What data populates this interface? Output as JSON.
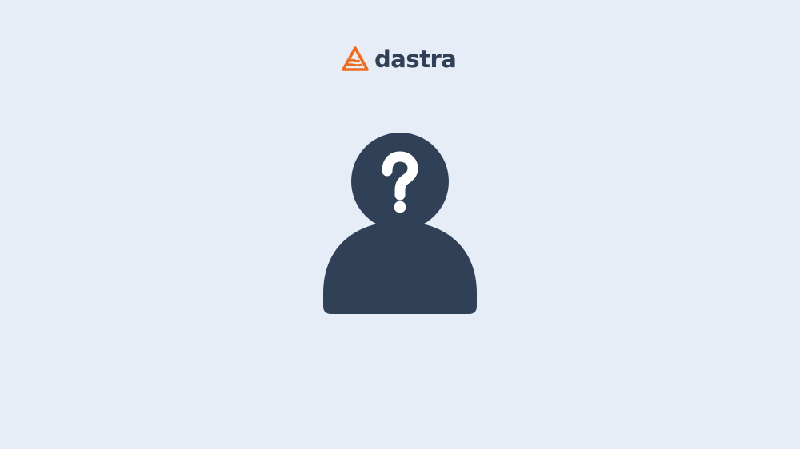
{
  "screen": {
    "background_color": "#e6edf6"
  },
  "logo": {
    "text": "dastra",
    "mark_icon": "dastra-mountain-logo-icon",
    "mark_color": "#f26a1b",
    "text_color": "#2f4057"
  },
  "illustration": {
    "icon": "unknown-person-icon",
    "badge_icon": "question-mark-icon",
    "figure_color": "#2f4057",
    "glyph_color": "#ffffff"
  }
}
